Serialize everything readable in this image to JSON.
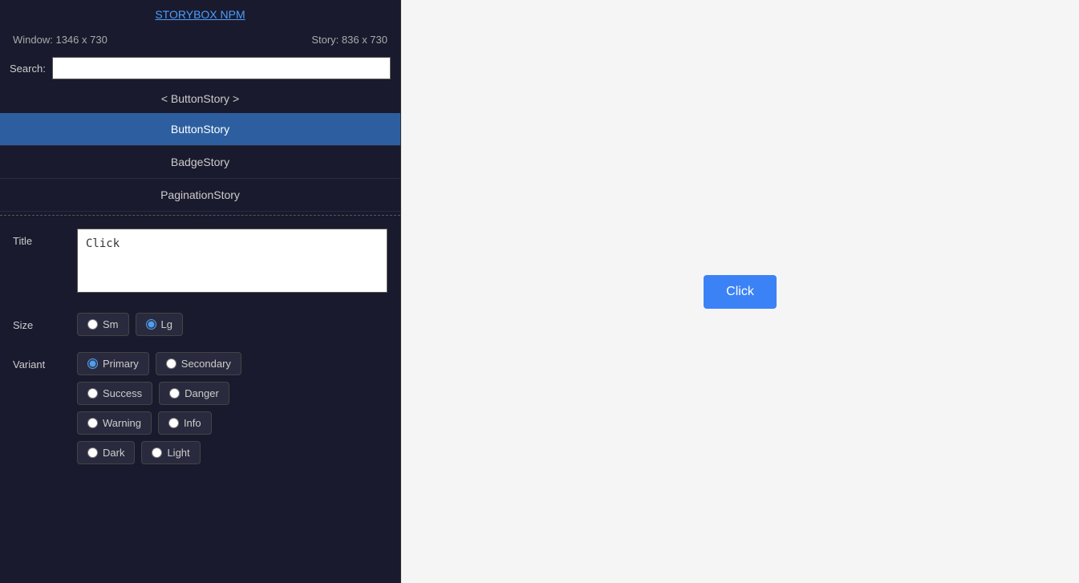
{
  "sidebar": {
    "brand_link": "STORYBOX NPM",
    "window_info": "Window: 1346 x 730",
    "story_info": "Story: 836 x 730",
    "search_label": "Search:",
    "search_placeholder": "",
    "current_story": "< ButtonStory >",
    "nav_items": [
      {
        "label": "ButtonStory",
        "active": true
      },
      {
        "label": "BadgeStory",
        "active": false
      },
      {
        "label": "PaginationStory",
        "active": false
      }
    ]
  },
  "controls": {
    "title_label": "Title",
    "title_value": "Click",
    "size_label": "Size",
    "size_options": [
      {
        "label": "Sm",
        "selected": false
      },
      {
        "label": "Lg",
        "selected": true
      }
    ],
    "variant_label": "Variant",
    "variant_rows": [
      [
        {
          "label": "Primary",
          "selected": true
        },
        {
          "label": "Secondary",
          "selected": false
        }
      ],
      [
        {
          "label": "Success",
          "selected": false
        },
        {
          "label": "Danger",
          "selected": false
        }
      ],
      [
        {
          "label": "Warning",
          "selected": false
        },
        {
          "label": "Info",
          "selected": false
        }
      ],
      [
        {
          "label": "Dark",
          "selected": false
        },
        {
          "label": "Light",
          "selected": false
        }
      ]
    ]
  },
  "preview": {
    "button_label": "Click",
    "button_color": "#3b82f6"
  }
}
